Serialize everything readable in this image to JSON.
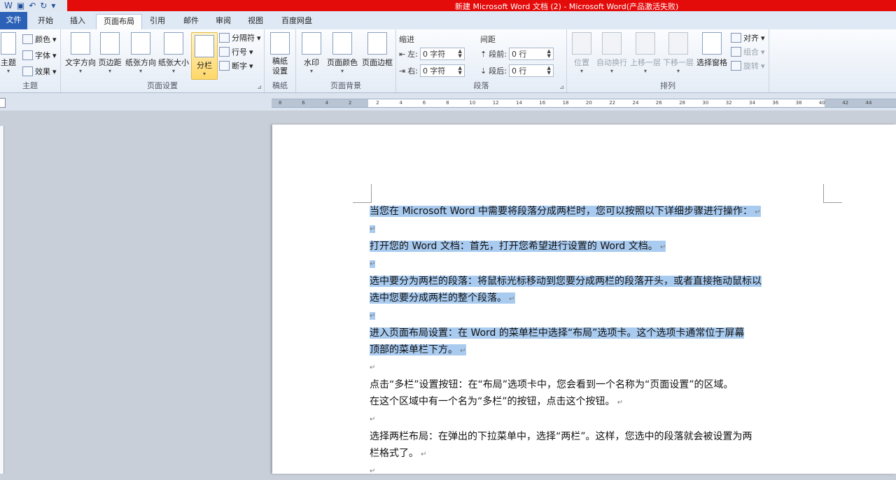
{
  "window": {
    "title": "新建 Microsoft Word 文档 (2)  -  Microsoft Word(产品激活失败)"
  },
  "qat": {
    "icons": [
      "word-icon",
      "save-icon",
      "undo-icon",
      "redo-icon",
      "customize-icon"
    ]
  },
  "tabs": [
    {
      "label": "文件"
    },
    {
      "label": "开始"
    },
    {
      "label": "插入"
    },
    {
      "label": "页面布局",
      "active": true
    },
    {
      "label": "引用"
    },
    {
      "label": "邮件"
    },
    {
      "label": "审阅"
    },
    {
      "label": "视图"
    },
    {
      "label": "百度网盘"
    }
  ],
  "ribbon": {
    "theme": {
      "label": "主题",
      "themes_label": "主题",
      "colors": "颜色",
      "fonts": "字体",
      "effects": "效果"
    },
    "page_setup": {
      "label": "页面设置",
      "text_direction": "文字方向",
      "margins": "页边距",
      "orientation": "纸张方向",
      "size": "纸张大小",
      "columns": "分栏",
      "breaks": "分隔符",
      "line_numbers": "行号",
      "hyphenation": "断字"
    },
    "manuscript": {
      "label": "稿纸",
      "button": "稿纸设置"
    },
    "page_background": {
      "label": "页面背景",
      "watermark": "水印",
      "page_color": "页面颜色",
      "page_borders": "页面边框"
    },
    "paragraph": {
      "label": "段落",
      "indent_title": "缩进",
      "spacing_title": "间距",
      "left_label": "左:",
      "left_value": "0 字符",
      "right_label": "右:",
      "right_value": "0 字符",
      "before_label": "段前:",
      "before_value": "0 行",
      "after_label": "段后:",
      "after_value": "0 行"
    },
    "arrange": {
      "label": "排列",
      "position": "位置",
      "wrap": "自动换行",
      "bring_forward": "上移一层",
      "send_backward": "下移一层",
      "selection_pane": "选择窗格",
      "align": "对齐",
      "group": "组合",
      "rotate": "旋转"
    }
  },
  "ruler": {
    "labels": [
      "8",
      "6",
      "4",
      "2",
      "2",
      "4",
      "6",
      "8",
      "10",
      "12",
      "14",
      "16",
      "18",
      "20",
      "22",
      "24",
      "26",
      "28",
      "30",
      "32",
      "34",
      "36",
      "38",
      "40",
      "42",
      "44"
    ]
  },
  "document": {
    "paragraph_mark": "↵",
    "paragraphs": [
      {
        "lines": [
          "当您在 Microsoft Word 中需要将段落分成两栏时，您可以按照以下详细步骤进行操作："
        ],
        "selected": true
      },
      {
        "lines": [
          ""
        ],
        "selected": true
      },
      {
        "lines": [
          "打开您的 Word 文档：首先，打开您希望进行设置的 Word 文档。"
        ],
        "selected": true
      },
      {
        "lines": [
          ""
        ],
        "selected": true
      },
      {
        "lines": [
          "选中要分为两栏的段落：将鼠标光标移动到您要分成两栏的段落开头，或者直接拖动鼠标以",
          "选中您要分成两栏的整个段落。"
        ],
        "selected": true
      },
      {
        "lines": [
          ""
        ],
        "selected": true
      },
      {
        "lines": [
          "进入页面布局设置：在 Word 的菜单栏中选择“布局”选项卡。这个选项卡通常位于屏幕",
          "顶部的菜单栏下方。"
        ],
        "selected": true
      },
      {
        "lines": [
          ""
        ],
        "selected": false
      },
      {
        "lines": [
          "点击“多栏”设置按钮：在“布局”选项卡中，您会看到一个名称为“页面设置”的区域。",
          "在这个区域中有一个名为“多栏”的按钮，点击这个按钮。"
        ],
        "selected": false
      },
      {
        "lines": [
          ""
        ],
        "selected": false
      },
      {
        "lines": [
          "选择两栏布局：在弹出的下拉菜单中，选择“两栏”。这样，您选中的段落就会被设置为两",
          "栏格式了。"
        ],
        "selected": false
      },
      {
        "lines": [
          ""
        ],
        "selected": false
      }
    ]
  }
}
